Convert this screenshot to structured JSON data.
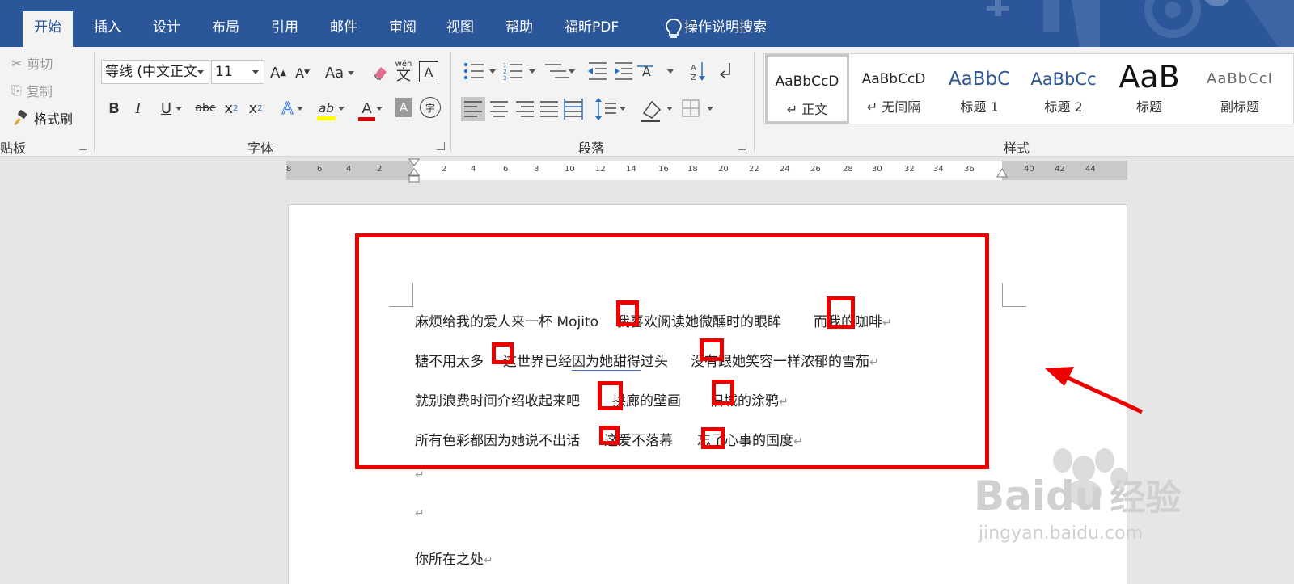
{
  "tabs": [
    {
      "label": "开始",
      "active": true
    },
    {
      "label": "插入"
    },
    {
      "label": "设计"
    },
    {
      "label": "布局"
    },
    {
      "label": "引用"
    },
    {
      "label": "邮件"
    },
    {
      "label": "审阅"
    },
    {
      "label": "视图"
    },
    {
      "label": "帮助"
    },
    {
      "label": "福昕PDF"
    }
  ],
  "tell_me": "操作说明搜索",
  "clipboard": {
    "cut": "剪切",
    "copy": "复制",
    "format_painter": "格式刷",
    "group_label": "贴板"
  },
  "font": {
    "name": "等线 (中文正文",
    "size": "11",
    "group_label": "字体",
    "change_case": "Aa",
    "phonetic": "wén",
    "phonetic_char": "文",
    "bold": "B",
    "italic": "I",
    "underline": "U",
    "strike": "abc",
    "subscript": "x",
    "sub_mark": "2",
    "superscript": "x",
    "sup_mark": "2",
    "grow": "A",
    "shrink": "A",
    "border_char": "A",
    "effects": "A",
    "highlight": "ab",
    "font_color": "A",
    "shading": "A",
    "enclose": "字"
  },
  "paragraph": {
    "group_label": "段落"
  },
  "styles": {
    "group_label": "样式",
    "items": [
      {
        "preview": "AaBbCcD",
        "name": "↵ 正文",
        "selected": true
      },
      {
        "preview": "AaBbCcD",
        "name": "↵ 无间隔"
      },
      {
        "preview": "AaBbC",
        "name": "标题 1"
      },
      {
        "preview": "AaBbCc",
        "name": "标题 2"
      },
      {
        "preview": "AaB",
        "name": "标题"
      },
      {
        "preview": "AaBbCcI",
        "name": "副标题"
      }
    ]
  },
  "ruler_labels": [
    "8",
    "6",
    "4",
    "2",
    "2",
    "4",
    "6",
    "8",
    "10",
    "12",
    "14",
    "16",
    "18",
    "20",
    "22",
    "24",
    "26",
    "28",
    "30",
    "32",
    "34",
    "36",
    "40",
    "42",
    "44"
  ],
  "document": {
    "line1": {
      "a": "麻烦给我的爱人来一杯 Mojito",
      "b": "我喜欢阅读她微醺时的眼眸",
      "c": "而我的咖啡"
    },
    "line2": {
      "a": "糖不用太多",
      "b": "这世界已经",
      "u": "因为她甜得",
      "c": "过头",
      "d": "没有跟她笑容一样浓郁的雪茄"
    },
    "line3": {
      "a": "就别浪费时间介绍收起来吧",
      "b": "拱廊的壁画",
      "c": "旧城的涂鸦"
    },
    "line4": {
      "a": "所有色彩都因为她说不出话",
      "b": "这爱不落幕",
      "c": "忘了心事的国度"
    },
    "line5": "你所在之处",
    "para_mark": "↵"
  },
  "watermark": {
    "brand": "Baidu",
    "service": "经验",
    "url": "jingyan.baidu.com"
  },
  "colors": {
    "ribbon_blue": "#2b579a",
    "annotation_red": "#e00000"
  }
}
